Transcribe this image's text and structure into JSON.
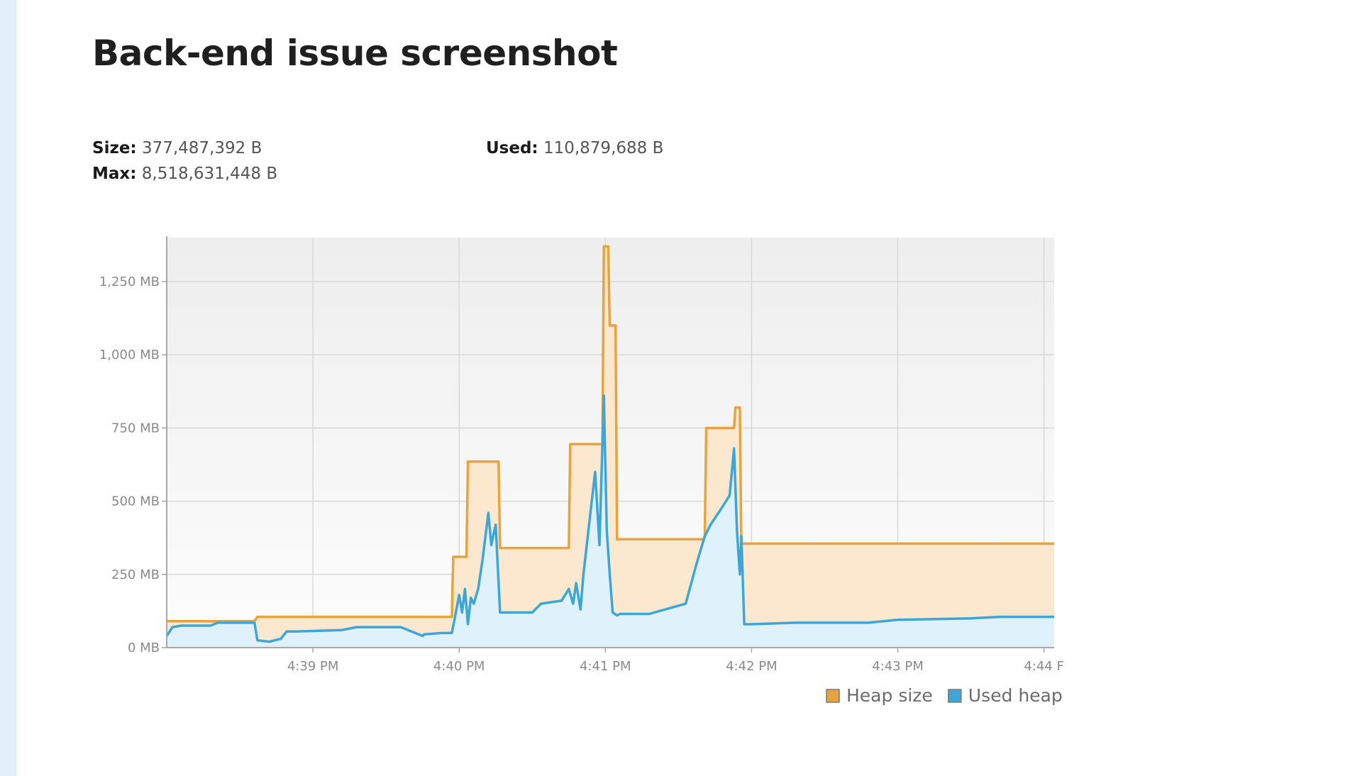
{
  "page": {
    "title": "Back-end issue screenshot"
  },
  "stats": {
    "size_label": "Size:",
    "size_value": "377,487,392 B",
    "used_label": "Used:",
    "used_value": "110,879,688 B",
    "max_label": "Max:",
    "max_value": "8,518,631,448 B"
  },
  "colors": {
    "heap_line": "#e8a33c",
    "heap_fill": "#fbe8cf",
    "used_line": "#3ea6d6",
    "used_fill": "#dff1fb",
    "plot_bg_top": "#eeeeee",
    "plot_bg_bottom": "#fdfdfd",
    "grid": "#d8d8d8",
    "axis": "#a8a8a8"
  },
  "chart_data": {
    "type": "area",
    "ylim": [
      0,
      1400
    ],
    "xlim": [
      0,
      6.07
    ],
    "x_unit": "minutes after 4:38 PM",
    "y_ticks": [
      0,
      250,
      500,
      750,
      1000,
      1250
    ],
    "y_tick_labels": [
      "0 MB",
      "250 MB",
      "500 MB",
      "750 MB",
      "1,000 MB",
      "1,250 MB"
    ],
    "x_ticks": [
      1,
      2,
      3,
      4,
      5,
      6
    ],
    "x_tick_labels": [
      "4:39 PM",
      "4:40 PM",
      "4:41 PM",
      "4:42 PM",
      "4:43 PM",
      "4:44 F"
    ],
    "legend_position": "bottom-right",
    "grid": true,
    "series": [
      {
        "name": "Heap size",
        "x": [
          0,
          0.6,
          0.62,
          1.95,
          1.96,
          2.05,
          2.06,
          2.27,
          2.28,
          2.75,
          2.76,
          2.98,
          2.99,
          3.02,
          3.03,
          3.07,
          3.08,
          3.68,
          3.69,
          3.88,
          3.89,
          3.92,
          3.93,
          6.07
        ],
        "values": [
          90,
          90,
          105,
          105,
          310,
          310,
          635,
          635,
          340,
          340,
          695,
          695,
          1370,
          1370,
          1100,
          1100,
          370,
          370,
          750,
          750,
          820,
          820,
          355,
          355
        ]
      },
      {
        "name": "Used heap",
        "x": [
          0,
          0.04,
          0.1,
          0.3,
          0.35,
          0.6,
          0.62,
          0.7,
          0.78,
          0.82,
          0.88,
          1.2,
          1.3,
          1.6,
          1.75,
          1.76,
          1.88,
          1.95,
          1.97,
          2.0,
          2.02,
          2.04,
          2.06,
          2.08,
          2.1,
          2.13,
          2.16,
          2.2,
          2.22,
          2.25,
          2.28,
          2.5,
          2.56,
          2.7,
          2.75,
          2.78,
          2.8,
          2.83,
          2.85,
          2.9,
          2.93,
          2.96,
          2.99,
          3.01,
          3.03,
          3.05,
          3.08,
          3.1,
          3.3,
          3.55,
          3.62,
          3.65,
          3.68,
          3.72,
          3.76,
          3.8,
          3.85,
          3.88,
          3.9,
          3.92,
          3.93,
          3.95,
          4.0,
          4.3,
          4.5,
          4.8,
          5.0,
          5.5,
          5.7,
          6.07
        ],
        "values": [
          40,
          70,
          75,
          75,
          85,
          85,
          25,
          20,
          30,
          55,
          55,
          60,
          70,
          70,
          40,
          45,
          50,
          50,
          100,
          180,
          120,
          200,
          80,
          170,
          150,
          200,
          300,
          460,
          350,
          420,
          120,
          120,
          150,
          160,
          200,
          150,
          220,
          130,
          250,
          470,
          600,
          350,
          860,
          400,
          250,
          120,
          110,
          115,
          115,
          150,
          280,
          330,
          380,
          420,
          450,
          480,
          520,
          680,
          400,
          250,
          380,
          80,
          80,
          85,
          85,
          85,
          95,
          100,
          105,
          105
        ]
      }
    ]
  }
}
